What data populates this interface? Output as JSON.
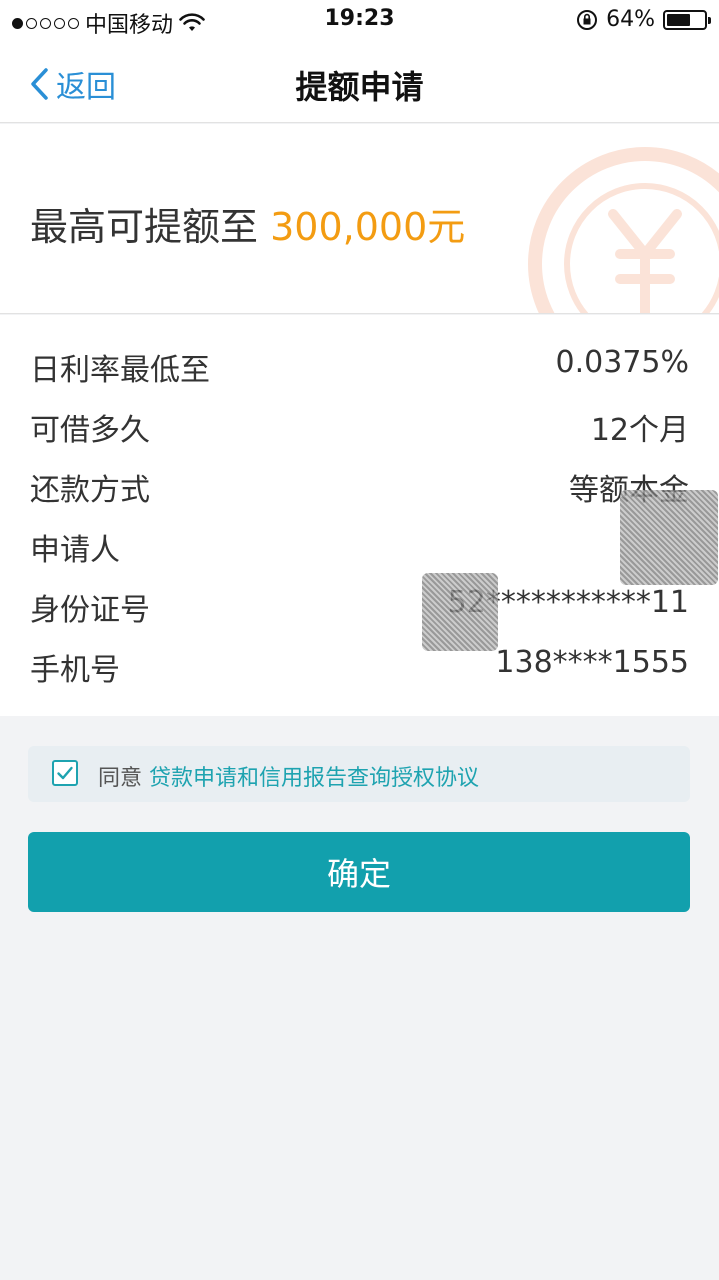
{
  "status_bar": {
    "carrier": "中国移动",
    "time": "19:23",
    "battery": "64%",
    "battery_level": 0.64
  },
  "nav": {
    "back_label": "返回",
    "title": "提额申请"
  },
  "hero": {
    "prefix": "最高可提额至",
    "amount": "300,000元"
  },
  "details": [
    {
      "label": "日利率最低至",
      "value": "0.0375%"
    },
    {
      "label": "可借多久",
      "value": "12个月"
    },
    {
      "label": "还款方式",
      "value": "等额本金"
    },
    {
      "label": "申请人",
      "value": ""
    },
    {
      "label": "身份证号",
      "value": "52***********11"
    },
    {
      "label": "手机号",
      "value": "138****1555"
    }
  ],
  "agreement": {
    "checked": true,
    "prefix": "同意",
    "link": "贷款申请和信用报告查询授权协议"
  },
  "confirm_label": "确定",
  "colors": {
    "accent": "#12a0ad",
    "link": "#1ea3b0",
    "amount": "#f39c12",
    "nav_link": "#2a8fd6"
  }
}
